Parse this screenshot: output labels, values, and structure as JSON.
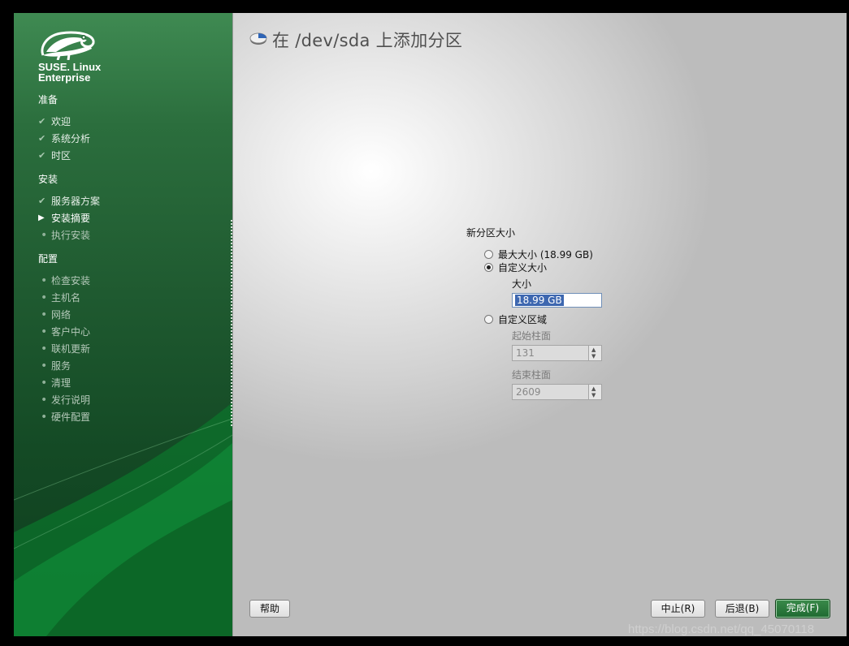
{
  "brand": {
    "line1": "SUSE. Linux",
    "line2": "Enterprise"
  },
  "steps": {
    "sections": [
      {
        "title": "准备",
        "items": [
          {
            "label": "欢迎",
            "state": "done"
          },
          {
            "label": "系统分析",
            "state": "done"
          },
          {
            "label": "时区",
            "state": "done"
          }
        ]
      },
      {
        "title": "安装",
        "items": [
          {
            "label": "服务器方案",
            "state": "done"
          },
          {
            "label": "安装摘要",
            "state": "current"
          },
          {
            "label": "执行安装",
            "state": "pending"
          }
        ]
      },
      {
        "title": "配置",
        "items": [
          {
            "label": "检查安装",
            "state": "pending"
          },
          {
            "label": "主机名",
            "state": "pending"
          },
          {
            "label": "网络",
            "state": "pending"
          },
          {
            "label": "客户中心",
            "state": "pending"
          },
          {
            "label": "联机更新",
            "state": "pending"
          },
          {
            "label": "服务",
            "state": "pending"
          },
          {
            "label": "清理",
            "state": "pending"
          },
          {
            "label": "发行说明",
            "state": "pending"
          },
          {
            "label": "硬件配置",
            "state": "pending"
          }
        ]
      }
    ]
  },
  "dialog": {
    "title": "在 /dev/sda 上添加分区",
    "group_label": "新分区大小",
    "max_size_label": "最大大小 (18.99 GB)",
    "custom_size_label": "自定义大小",
    "size_label": "大小",
    "size_value": "18.99 GB",
    "custom_region_label": "自定义区域",
    "start_cyl_label": "起始柱面",
    "start_cyl_value": "131",
    "end_cyl_label": "结束柱面",
    "end_cyl_value": "2609",
    "selected_option": "custom_size"
  },
  "buttons": {
    "help": "帮助",
    "abort": "中止(R)",
    "back": "后退(B)",
    "finish": "完成(F)"
  },
  "watermark": "https://blog.csdn.net/qq_45070118",
  "colors": {
    "accent_green": "#1f6a31",
    "selection_blue": "#3d67b0"
  }
}
